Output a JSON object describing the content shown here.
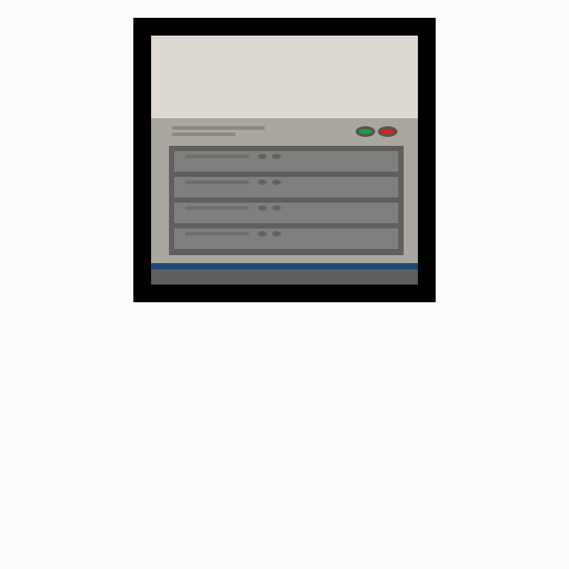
{
  "colors": {
    "frame": "#000000",
    "top_pane": "#dedad3",
    "panel": "#a9a79f",
    "rack": "#5f5f5e",
    "bay": "#7f7f7e",
    "status_ok": "#1f9a46",
    "status_error": "#d62020",
    "taskbar_accent": "#1c4a72",
    "taskbar": "#5f5f5e"
  },
  "panel": {
    "status_lights": [
      {
        "name": "status-green-light",
        "color": "green"
      },
      {
        "name": "status-red-light",
        "color": "red"
      }
    ],
    "bays": [
      {
        "name": "drive-bay-1"
      },
      {
        "name": "drive-bay-2"
      },
      {
        "name": "drive-bay-3"
      },
      {
        "name": "drive-bay-4"
      }
    ]
  }
}
